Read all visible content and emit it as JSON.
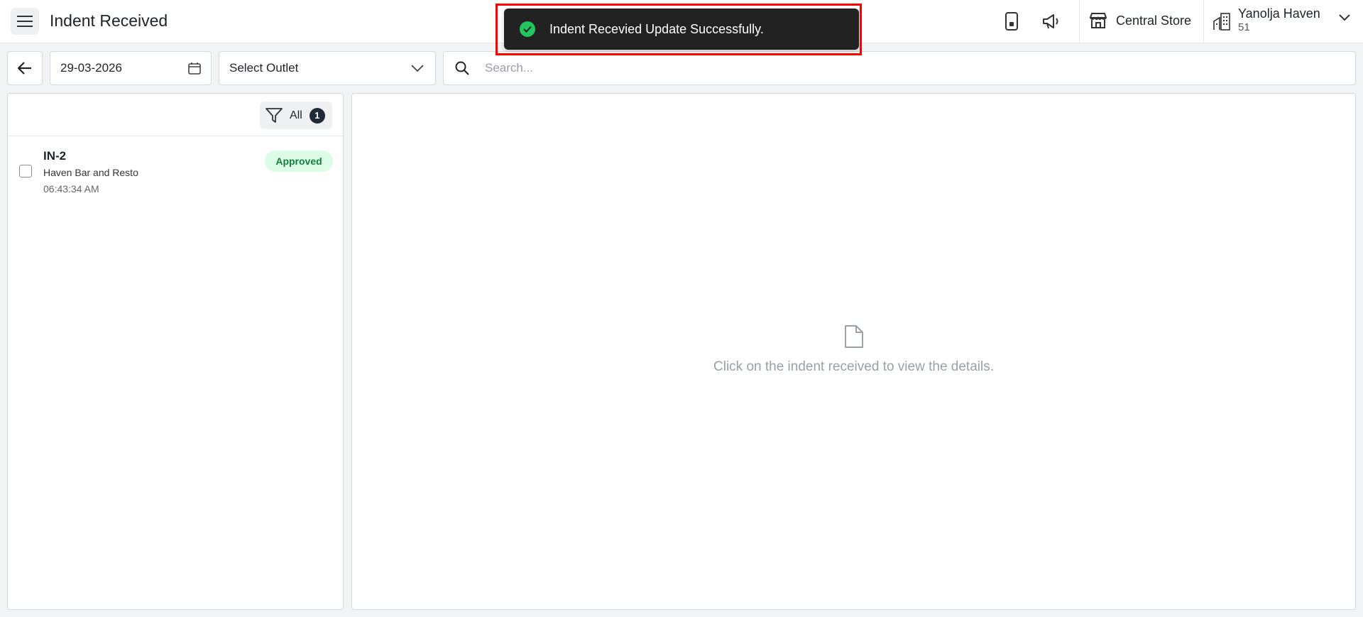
{
  "header": {
    "title": "Indent Received",
    "store_name": "Central Store",
    "hotel_name": "Yanolja Haven",
    "hotel_id": "51"
  },
  "toast": {
    "message": "Indent Recevied Update Successfully."
  },
  "filters": {
    "date": "29-03-2026",
    "outlet_placeholder": "Select Outlet",
    "search_placeholder": "Search..."
  },
  "list": {
    "filter_label": "All",
    "filter_count": "1",
    "items": [
      {
        "id": "IN-2",
        "outlet": "Haven Bar and Resto",
        "time": "06:43:34 AM",
        "status": "Approved"
      }
    ]
  },
  "details": {
    "empty_message": "Click on the indent received to view the details."
  },
  "icons": {
    "menu": "hamburger-icon",
    "mobile": "mobile-icon",
    "announcement": "megaphone-icon",
    "store": "store-icon",
    "hotel": "building-icon",
    "back": "arrow-left-icon",
    "calendar": "calendar-icon",
    "search": "search-icon",
    "filter": "filter-icon",
    "document": "document-icon"
  },
  "colors": {
    "toast_bg": "#222222",
    "success": "#22c55e",
    "approved_bg": "#dcfce7",
    "approved_text": "#15803d"
  }
}
